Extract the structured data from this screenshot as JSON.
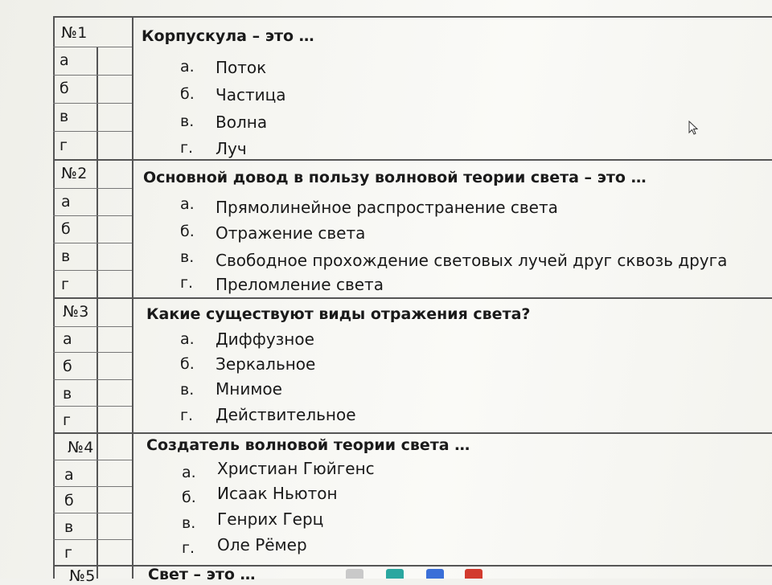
{
  "questions": [
    {
      "num": "№1",
      "text": "Корпускула – это …",
      "letters": [
        "а",
        "б",
        "в",
        "г"
      ],
      "options": [
        {
          "letter": "а.",
          "text": "Поток"
        },
        {
          "letter": "б.",
          "text": "Частица"
        },
        {
          "letter": "в.",
          "text": "Волна"
        },
        {
          "letter": "г.",
          "text": "Луч"
        }
      ]
    },
    {
      "num": "№2",
      "text": "Основной довод в пользу волновой теории света – это …",
      "letters": [
        "а",
        "б",
        "в",
        "г"
      ],
      "options": [
        {
          "letter": "а.",
          "text": "Прямолинейное распространение света"
        },
        {
          "letter": "б.",
          "text": "Отражение света"
        },
        {
          "letter": "в.",
          "text": "Свободное прохождение световых лучей друг сквозь друга"
        },
        {
          "letter": "г.",
          "text": "Преломление света"
        }
      ]
    },
    {
      "num": "№3",
      "text": "Какие существуют виды отражения света?",
      "letters": [
        "а",
        "б",
        "в",
        "г"
      ],
      "options": [
        {
          "letter": "а.",
          "text": "Диффузное"
        },
        {
          "letter": "б.",
          "text": "Зеркальное"
        },
        {
          "letter": "в.",
          "text": "Мнимое"
        },
        {
          "letter": "г.",
          "text": "Действительное"
        }
      ]
    },
    {
      "num": "№4",
      "text": "Создатель волновой теории света …",
      "letters": [
        "а",
        "б",
        "в",
        "г"
      ],
      "options": [
        {
          "letter": "а.",
          "text": "Христиан Гюйгенс"
        },
        {
          "letter": "б.",
          "text": "Исаак Ньютон"
        },
        {
          "letter": "в.",
          "text": "Генрих Герц"
        },
        {
          "letter": "г.",
          "text": "Оле Рёмер"
        }
      ]
    },
    {
      "num": "№5",
      "text": "Свет – это …",
      "letters": [],
      "options": []
    }
  ],
  "icons": {
    "cursor": "mouse-pointer-icon"
  }
}
